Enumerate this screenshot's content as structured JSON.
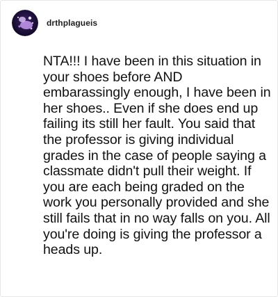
{
  "post": {
    "username": "drthplagueis",
    "avatar_icon": "galaxy-avatar-icon",
    "body": "NTA!!! I have been in this situation in your shoes before AND embarassingly enough, I have been in her shoes.. Even if she does end up failing its still her fault. You said that the professor is giving individual grades in the case of people saying a classmate didn't pull their weight. If you are each being graded on the work you personally provided and she still fails that in no way falls on you. All you're doing is giving the professor a heads up."
  },
  "colors": {
    "border": "#e6e6e6",
    "text": "#111111",
    "avatar_bg": "#1a0f3a",
    "avatar_accent": "#b98ae8"
  }
}
